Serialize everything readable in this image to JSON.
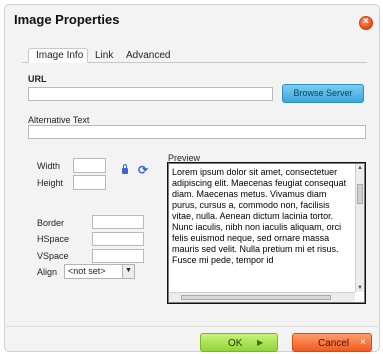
{
  "dialog": {
    "title": "Image Properties",
    "close_label": "×"
  },
  "tabs": [
    {
      "label": "Image Info"
    },
    {
      "label": "Link"
    },
    {
      "label": "Advanced"
    }
  ],
  "form": {
    "url_label": "URL",
    "url_value": "",
    "browse_label": "Browse Server",
    "alt_label": "Alternative Text",
    "alt_value": "",
    "width_label": "Width",
    "height_label": "Height",
    "border_label": "Border",
    "hspace_label": "HSpace",
    "vspace_label": "VSpace",
    "align_label": "Align",
    "align_value": "<not set>"
  },
  "preview": {
    "label": "Preview",
    "text": "Lorem ipsum dolor sit amet, consectetuer adipiscing elit. Maecenas feugiat consequat diam. Maecenas metus. Vivamus diam purus, cursus a, commodo non, facilisis vitae, nulla. Aenean dictum lacinia tortor. Nunc iaculis, nibh non iaculis aliquam, orci felis euismod neque, sed ornare massa mauris sed velit. Nulla pretium mi et risus. Fusce mi pede, tempor id"
  },
  "footer": {
    "ok_label": "OK",
    "cancel_label": "Cancel"
  }
}
